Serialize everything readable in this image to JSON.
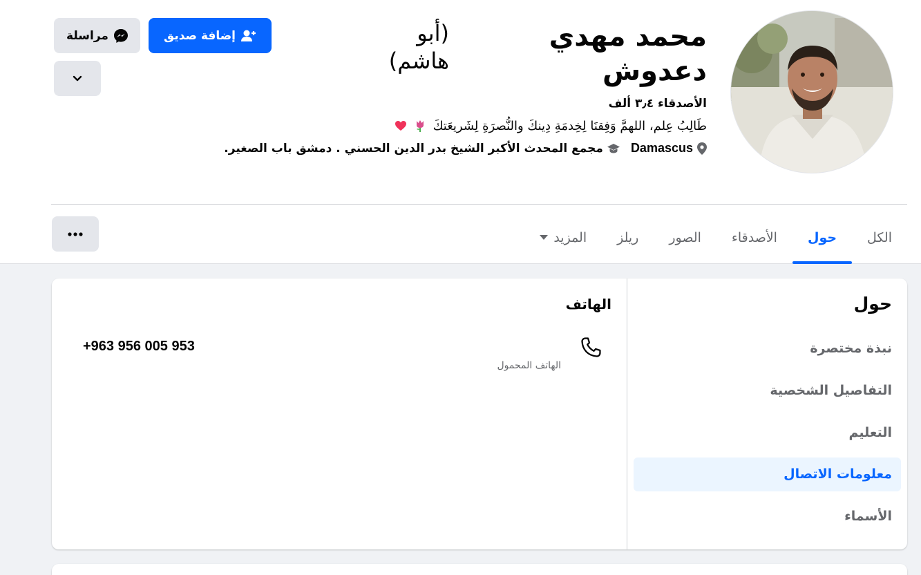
{
  "profile": {
    "name": "محمد مهدي دعدوش",
    "alternate_name": "(أبو هاشم)",
    "friends": "الأصدقاء ٣٫٤ ألف",
    "bio": "طَالِبُ عِلم، اللهمَّ وَفِقنَا لِخِدمَةِ دِينكَ والنُّصرَةِ لِشَريعَتكَ",
    "location": "Damascus",
    "education": "مجمع المحدث الأكبر الشيخ بدر الدين الحسني . دمشق باب الصغير."
  },
  "actions": {
    "add_friend": "إضافة صديق",
    "message": "مراسلة"
  },
  "tabs": [
    {
      "label": "الكل"
    },
    {
      "label": "حول"
    },
    {
      "label": "الأصدقاء"
    },
    {
      "label": "الصور"
    },
    {
      "label": "ريلز"
    },
    {
      "label": "المزيد"
    }
  ],
  "about": {
    "title": "حول",
    "menu": [
      {
        "label": "نبذة مختصرة"
      },
      {
        "label": "التفاصيل الشخصية"
      },
      {
        "label": "التعليم"
      },
      {
        "label": "معلومات الاتصال"
      },
      {
        "label": "الأسماء"
      }
    ],
    "active_item": "معلومات الاتصال"
  },
  "contact": {
    "section_title": "الهاتف",
    "phone_number": "+963 956 005 953",
    "phone_type": "الهاتف المحمول"
  },
  "colors": {
    "accent": "#0866ff",
    "secondary_text": "#65676b",
    "button_gray": "#e4e6eb",
    "active_menu_bg": "#ebf5ff"
  },
  "icons": [
    "user-plus-icon",
    "messenger-icon",
    "chevron-down-icon",
    "location-pin-icon",
    "graduation-cap-icon",
    "caret-down-icon",
    "more-dots-icon",
    "phone-icon",
    "tulip-icon",
    "heart-icon"
  ]
}
